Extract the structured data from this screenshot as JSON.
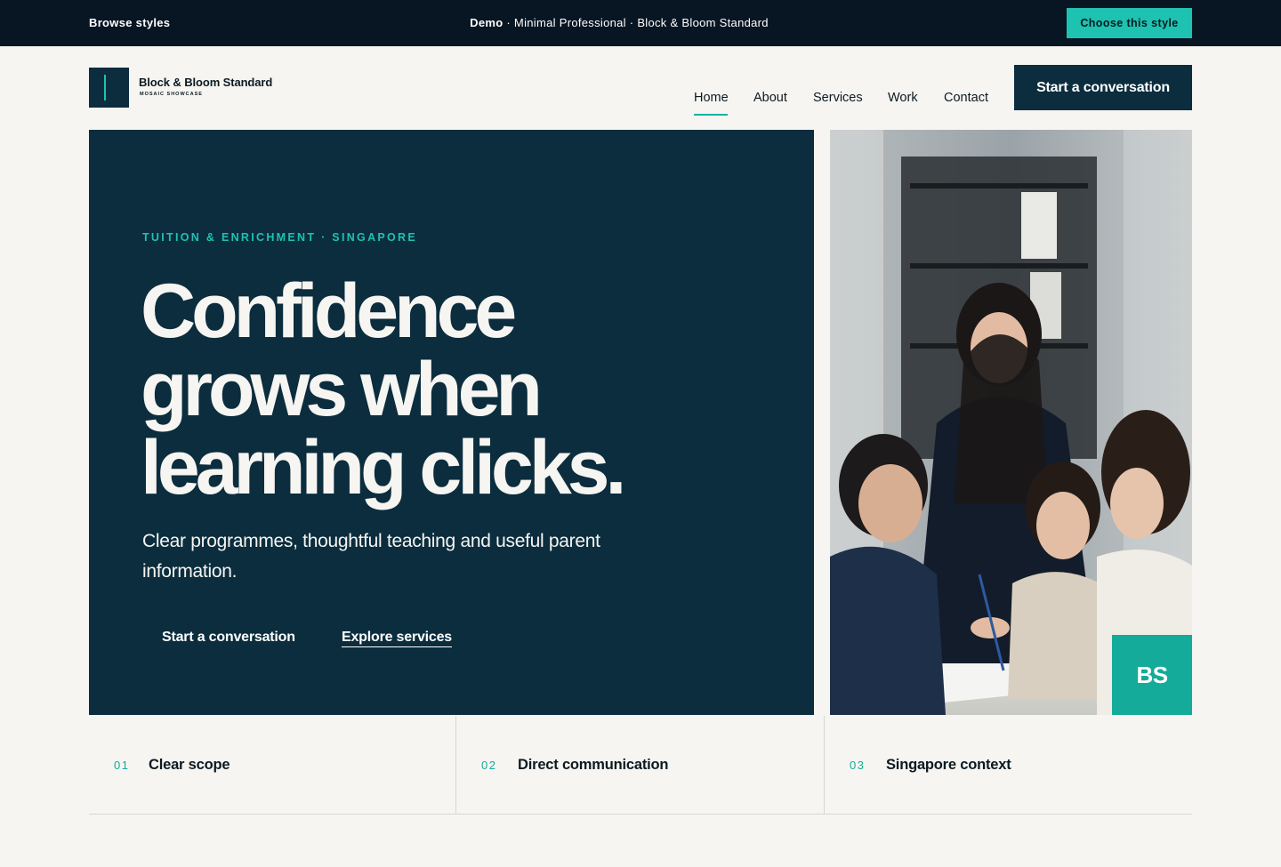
{
  "demo_bar": {
    "browse_label": "Browse styles",
    "demo_label": "Demo",
    "crumb_text": " · Minimal Professional · Block & Bloom Standard",
    "choose_label": "Choose this style"
  },
  "header": {
    "brand_name": "Block & Bloom Standard",
    "brand_sub": "MOSAIC SHOWCASE",
    "nav": [
      {
        "label": "Home",
        "active": true
      },
      {
        "label": "About"
      },
      {
        "label": "Services"
      },
      {
        "label": "Work"
      },
      {
        "label": "Contact"
      }
    ],
    "cta_label": "Start a conversation"
  },
  "hero": {
    "eyebrow": "TUITION & ENRICHMENT · SINGAPORE",
    "headline": "Confidence grows when learning clicks.",
    "subhead": "Clear programmes, thoughtful teaching and useful parent information.",
    "primary_label": "Start a conversation",
    "secondary_label": "Explore services",
    "badge": "BS"
  },
  "features": [
    {
      "num": "01",
      "title": "Clear scope"
    },
    {
      "num": "02",
      "title": "Direct communication"
    },
    {
      "num": "03",
      "title": "Singapore context"
    }
  ],
  "colors": {
    "navy": "#0b2d3e",
    "teal": "#1ec2b0",
    "badge_teal": "#14ab9b",
    "background": "#f6f5f1",
    "demo_bar": "#081523"
  }
}
